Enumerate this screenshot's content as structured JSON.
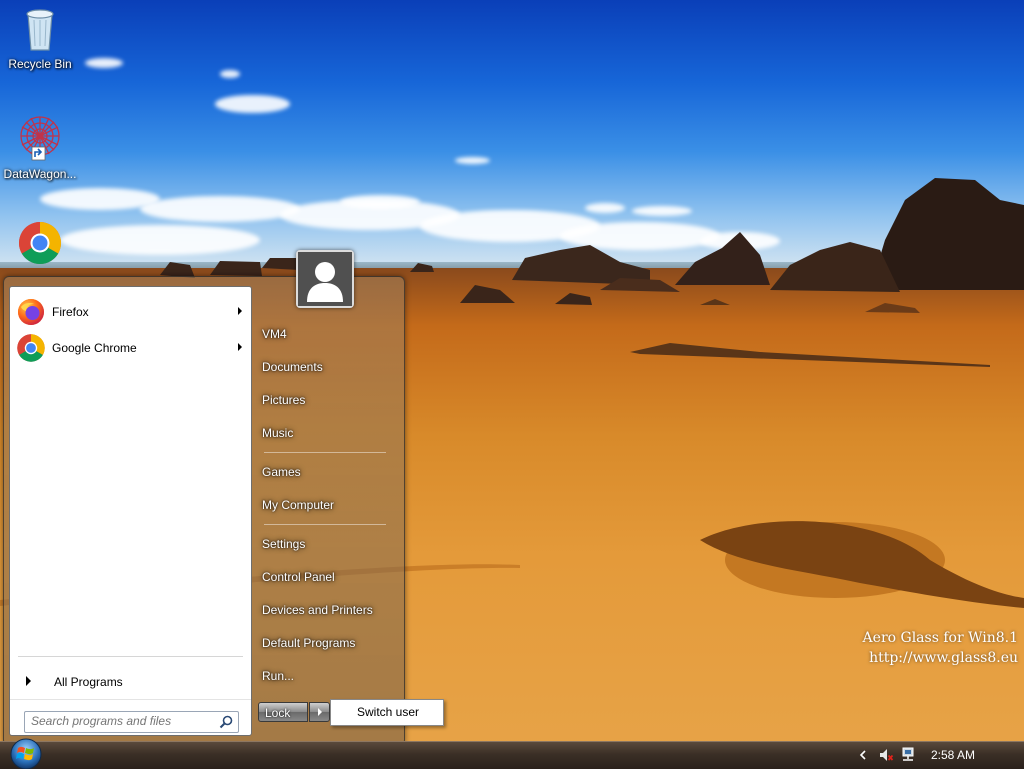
{
  "desktop": {
    "icons": [
      {
        "label": "Recycle Bin",
        "icon": "recycle-bin-icon"
      },
      {
        "label": "DataWagon...",
        "icon": "datawagon-shortcut-icon"
      },
      {
        "label": "",
        "icon": "chrome-icon"
      }
    ],
    "watermark": {
      "line1": "Aero Glass for Win8.1",
      "line2": "http://www.glass8.eu"
    }
  },
  "start_menu": {
    "pinned_programs": [
      {
        "label": "Firefox",
        "icon": "firefox-icon",
        "has_submenu": true
      },
      {
        "label": "Google Chrome",
        "icon": "chrome-icon",
        "has_submenu": true
      }
    ],
    "all_programs_label": "All Programs",
    "search_placeholder": "Search programs and files",
    "right_items": {
      "user": "VM4",
      "documents": "Documents",
      "pictures": "Pictures",
      "music": "Music",
      "games": "Games",
      "my_computer": "My Computer",
      "settings": "Settings",
      "control_panel": "Control Panel",
      "devices_printers": "Devices and Printers",
      "default_programs": "Default Programs",
      "run": "Run..."
    },
    "lock_label": "Lock",
    "power_popup": {
      "item": "Switch user"
    }
  },
  "taskbar": {
    "clock": "2:58 AM"
  }
}
